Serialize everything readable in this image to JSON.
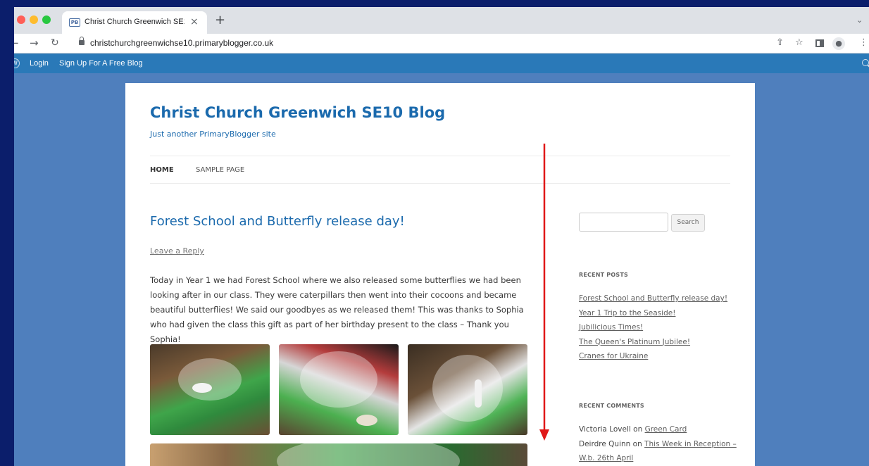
{
  "browser": {
    "tab_title": "Christ Church Greenwich SE10",
    "tab_favicon_text": "PB",
    "new_tab_symbol": "+",
    "close_symbol": "×",
    "url": "christchurchgreenwichse10.primaryblogger.co.uk"
  },
  "adminbar": {
    "login": "Login",
    "signup": "Sign Up For A Free Blog"
  },
  "site": {
    "title": "Christ Church Greenwich SE10 Blog",
    "tagline": "Just another PrimaryBlogger site",
    "menu": {
      "home": "HOME",
      "sample": "SAMPLE PAGE"
    }
  },
  "post": {
    "title": "Forest School and Butterfly release day!",
    "leave_reply": "Leave a Reply",
    "body": "Today in Year 1 we had Forest School where we also released some butterflies we had been looking after in our class. They were caterpillars then went into their cocoons and became beautiful butterflies! We said our goodbyes as we released them! This was thanks to Sophia who had given the class this gift as part of her birthday present to the class – Thank you Sophia!"
  },
  "sidebar": {
    "search_button": "Search",
    "recent_posts_title": "RECENT POSTS",
    "recent_posts": [
      "Forest School and Butterfly release day!",
      "Year 1 Trip to the Seaside!",
      "Jubilicious Times!",
      "The Queen's Platinum Jubilee!",
      "Cranes for Ukraine"
    ],
    "recent_comments_title": "RECENT COMMENTS",
    "comments": [
      {
        "author": "Victoria Lovell",
        "on": "on",
        "post": "Green Card"
      },
      {
        "author": "Deirdre Quinn",
        "on": "on",
        "post": "This Week in Reception – W.b. 26th April"
      }
    ]
  },
  "colors": {
    "page_background": "#4f7fbd",
    "adminbar": "#2a79b8",
    "link_blue": "#1b6aad",
    "annotation_red": "#e01818"
  }
}
